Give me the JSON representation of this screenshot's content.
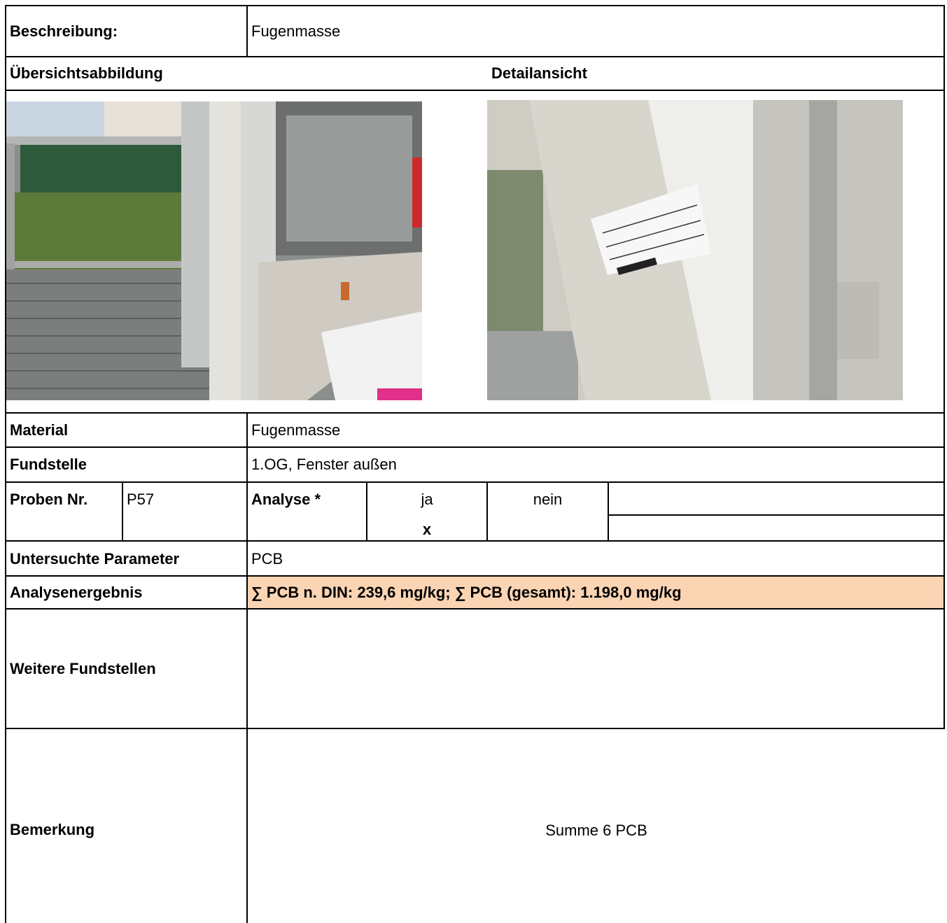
{
  "beschreibung": {
    "label": "Beschreibung:",
    "value": "Fugenmasse"
  },
  "images": {
    "overview_label": "Übersichtsabbildung",
    "detail_label": "Detailansicht"
  },
  "material": {
    "label": "Material",
    "value": "Fugenmasse"
  },
  "fundstelle": {
    "label": "Fundstelle",
    "value": "1.OG, Fenster außen"
  },
  "probe": {
    "label": "Proben Nr.",
    "value": "P57"
  },
  "analyse": {
    "label": "Analyse *",
    "ja": "ja",
    "nein": "nein",
    "mark": "x"
  },
  "parameter": {
    "label": "Untersuchte Parameter",
    "value": "PCB"
  },
  "ergebnis": {
    "label": "Analysenergebnis",
    "value": "∑ PCB n. DIN: 239,6 mg/kg; ∑ PCB (gesamt): 1.198,0 mg/kg",
    "highlight_color": "#fbd4b4"
  },
  "weitere": {
    "label": "Weitere Fundstellen",
    "value": ""
  },
  "bemerkung": {
    "label": "Bemerkung",
    "value": "Summe 6 PCB"
  }
}
